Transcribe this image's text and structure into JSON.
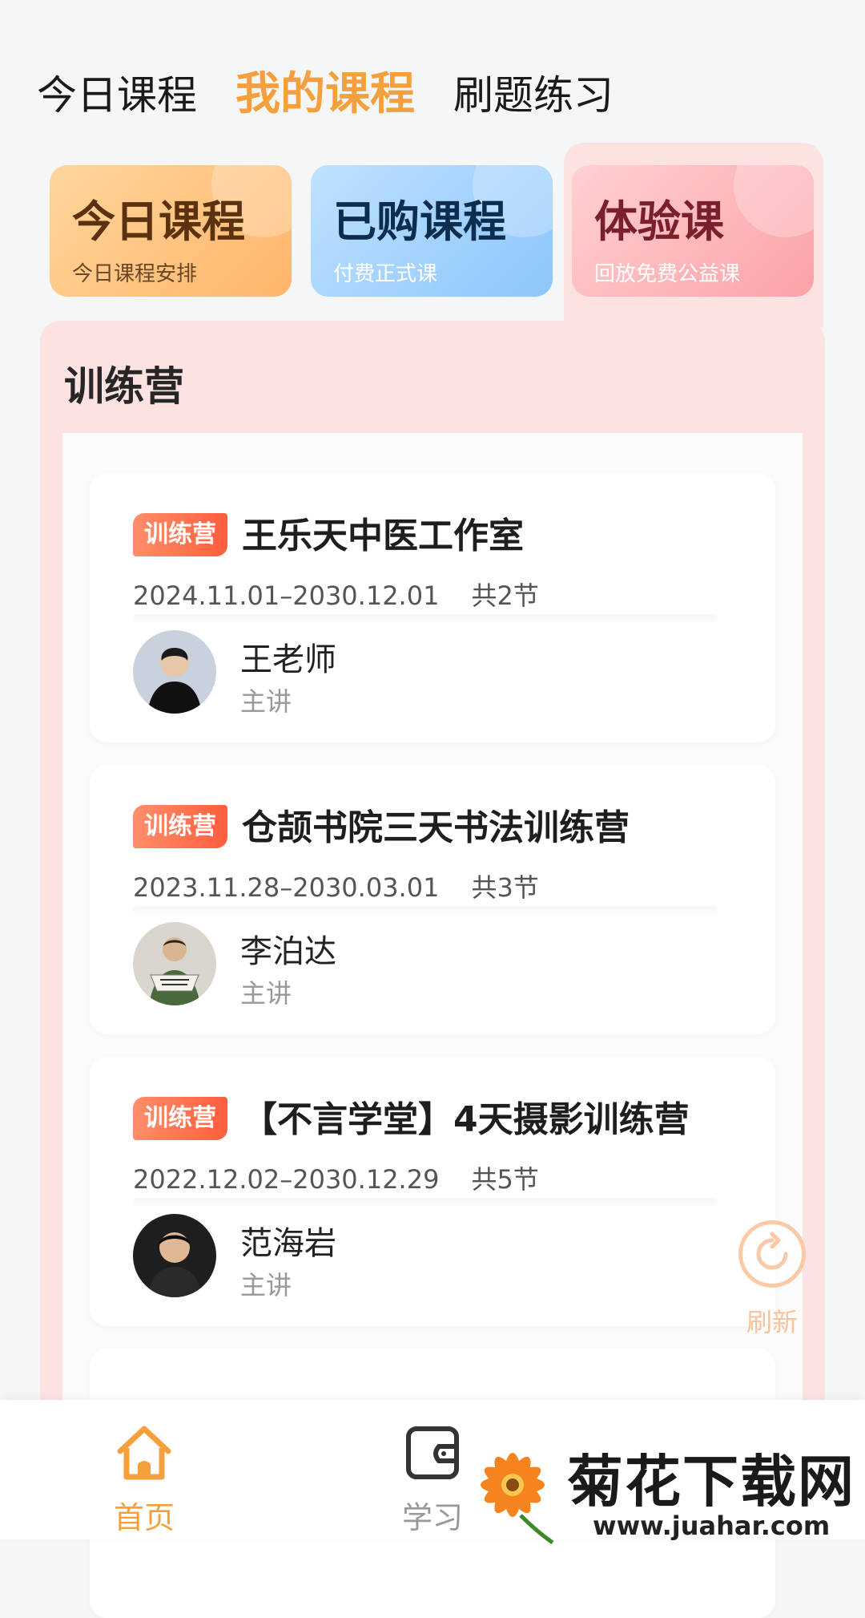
{
  "top_tabs": [
    "今日课程",
    "我的课程",
    "刷题练习"
  ],
  "categories": [
    {
      "title": "今日课程",
      "subtitle": "今日课程安排"
    },
    {
      "title": "已购课程",
      "subtitle": "付费正式课"
    },
    {
      "title": "体验课",
      "subtitle": "回放免费公益课"
    }
  ],
  "section_title": "训练营",
  "courses": [
    {
      "tag": "训练营",
      "title": "王乐天中医工作室",
      "date_range": "2024.11.01–2030.12.01",
      "lessons": "共2节",
      "teacher": "王老师",
      "role": "主讲"
    },
    {
      "tag": "训练营",
      "title": "仓颉书院三天书法训练营",
      "date_range": "2023.11.28–2030.03.01",
      "lessons": "共3节",
      "teacher": "李泊达",
      "role": "主讲"
    },
    {
      "tag": "训练营",
      "title": "【不言学堂】4天摄影训练营",
      "date_range": "2022.12.02–2030.12.29",
      "lessons": "共5节",
      "teacher": "范海岩",
      "role": "主讲"
    }
  ],
  "refresh_label": "刷新",
  "bottom_nav": [
    {
      "label": "首页",
      "icon": "home-icon"
    },
    {
      "label": "学习",
      "icon": "wallet-icon"
    }
  ],
  "watermark": {
    "title": "菊花下载网",
    "url": "www.juahar.com"
  }
}
